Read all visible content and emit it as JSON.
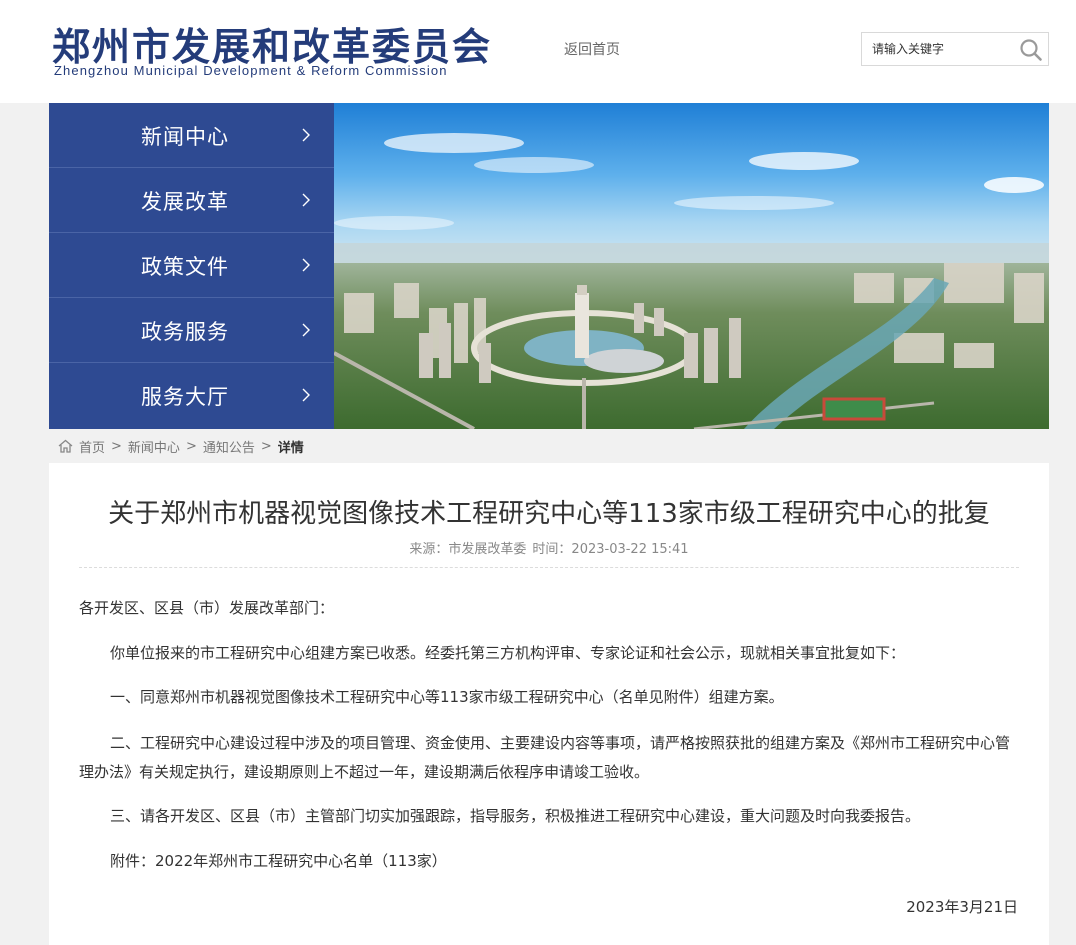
{
  "header": {
    "logo_cn": "郑州市发展和改革委员会",
    "logo_en": "Zhengzhou Municipal Development & Reform Commission",
    "back_home": "返回首页",
    "search": {
      "placeholder": "请输入关键字",
      "value": ""
    }
  },
  "nav": {
    "items": [
      {
        "label": "新闻中心"
      },
      {
        "label": "发展改革"
      },
      {
        "label": "政策文件"
      },
      {
        "label": "政务服务"
      },
      {
        "label": "服务大厅"
      }
    ]
  },
  "breadcrumb": {
    "items": [
      "首页",
      "新闻中心",
      "通知公告"
    ],
    "separator": ">",
    "current": "详情"
  },
  "article": {
    "title": "关于郑州市机器视觉图像技术工程研究中心等113家市级工程研究中心的批复",
    "meta_source": "来源：市发展改革委",
    "meta_time": "时间：2023-03-22 15:41",
    "paragraphs": [
      "各开发区、区县（市）发展改革部门：",
      "你单位报来的市工程研究中心组建方案已收悉。经委托第三方机构评审、专家论证和社会公示，现就相关事宜批复如下：",
      "一、同意郑州市机器视觉图像技术工程研究中心等113家市级工程研究中心（名单见附件）组建方案。",
      "二、工程研究中心建设过程中涉及的项目管理、资金使用、主要建设内容等事项，请严格按照获批的组建方案及《郑州市工程研究中心管理办法》有关规定执行，建设期原则上不超过一年，建设期满后依程序申请竣工验收。",
      "三、请各开发区、区县（市）主管部门切实加强跟踪，指导服务，积极推进工程研究中心建设，重大问题及时向我委报告。",
      "附件：2022年郑州市工程研究中心名单（113家）"
    ],
    "date": "2023年3月21日"
  },
  "colors": {
    "brand": "#243c7a",
    "nav_bg": "#2e4a92",
    "page_bg": "#f1f1f1"
  }
}
